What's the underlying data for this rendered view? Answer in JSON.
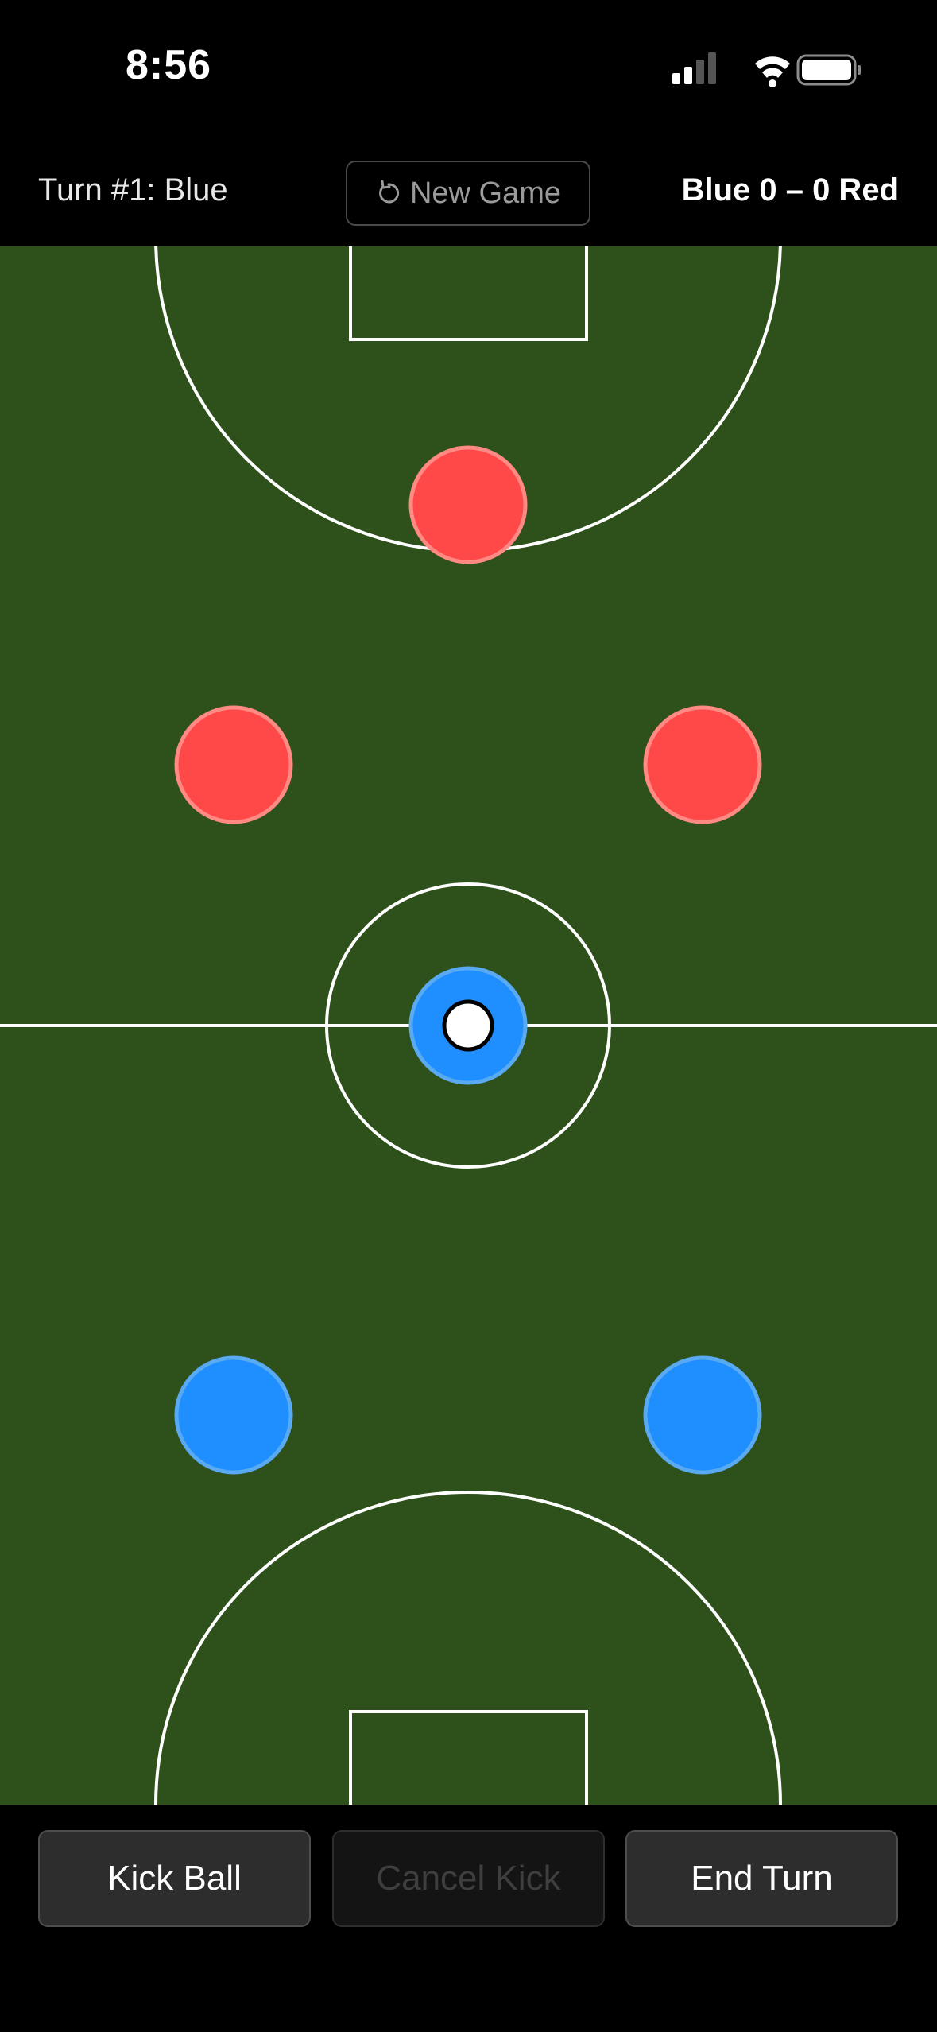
{
  "status_bar": {
    "time": "8:56",
    "icons": [
      "cellular-signal-icon",
      "wifi-icon",
      "battery-icon"
    ]
  },
  "header": {
    "turn_label": "Turn #1: Blue",
    "new_game_label": "New Game",
    "new_game_icon": "restart-icon",
    "score_label": "Blue 0 – 0 Red"
  },
  "pitch": {
    "grass_color": "#2e501a",
    "line_color": "#ffffff",
    "teams": {
      "red": {
        "name": "Red",
        "fill": "#ff4848",
        "stroke": "#ff8a84",
        "players": 3
      },
      "blue": {
        "name": "Blue",
        "fill": "#1f8eff",
        "stroke": "#5aaaf2",
        "players": 3
      }
    },
    "ball_holder": "blue"
  },
  "actions": {
    "kick_label": "Kick Ball",
    "cancel_label": "Cancel Kick",
    "cancel_enabled": false,
    "end_label": "End Turn"
  }
}
